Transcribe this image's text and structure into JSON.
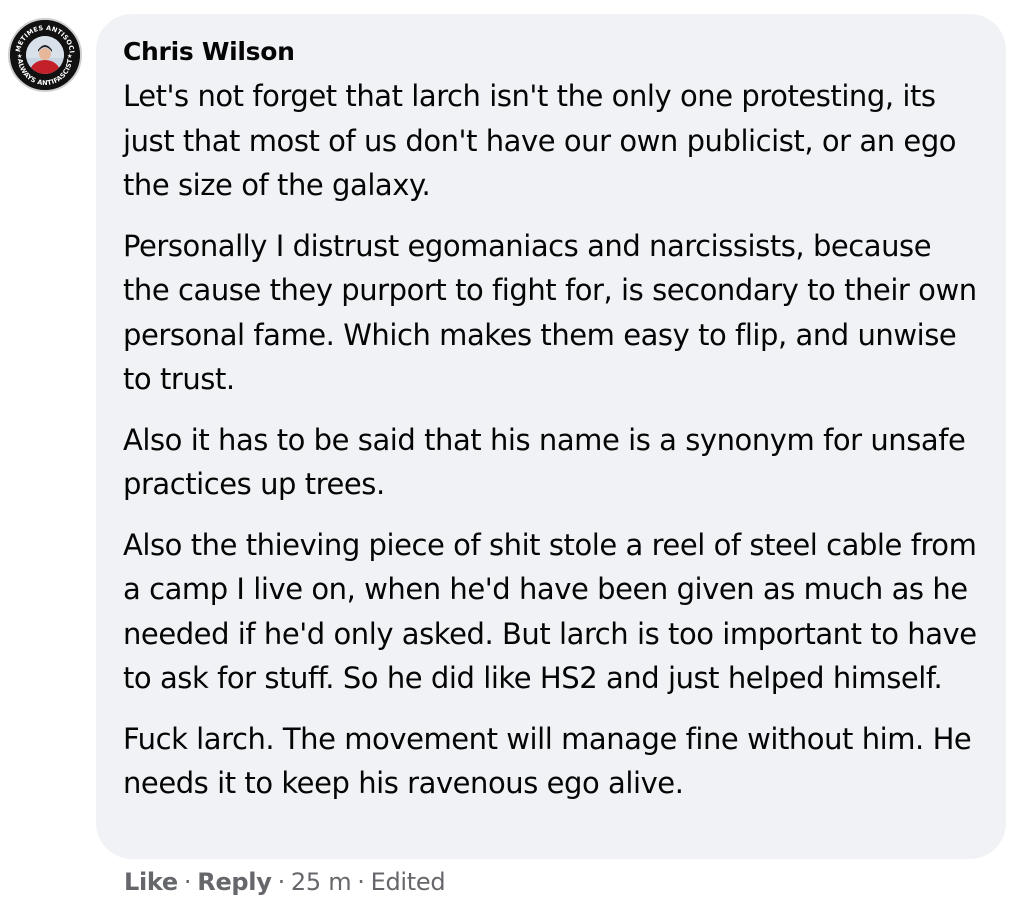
{
  "comment": {
    "author": "Chris Wilson",
    "avatar_text": {
      "top": "SOMETIMES ANTISOCIAL",
      "bottom": "ALWAYS ANTIFASCIST"
    },
    "paragraphs": [
      "Let's not forget that larch isn't the only one protesting, its just that most of us don't have our own publicist, or an ego the size of the galaxy.",
      "Personally I distrust egomaniacs and narcissists, because the cause they purport to fight for, is secondary to their own personal fame. Which makes them easy to flip, and unwise to trust.",
      "Also it has to be said that his name is a synonym for unsafe practices up trees.",
      "Also the thieving piece of shit stole a reel of steel cable from a camp I live on, when he'd have been given as much as he needed if he'd only asked. But larch is too important to have to ask for stuff. So he did like HS2 and just helped himself.",
      "Fuck larch. The movement will manage fine without him. He needs it to keep his ravenous ego alive."
    ],
    "actions": {
      "like": "Like",
      "reply": "Reply",
      "separator": "·",
      "time": "25 m",
      "edited": "Edited"
    }
  },
  "colors": {
    "bubble_bg": "#f0f2f5",
    "text": "#050505",
    "meta_text": "#65676b"
  },
  "icons": {
    "avatar": "profile-photo"
  }
}
